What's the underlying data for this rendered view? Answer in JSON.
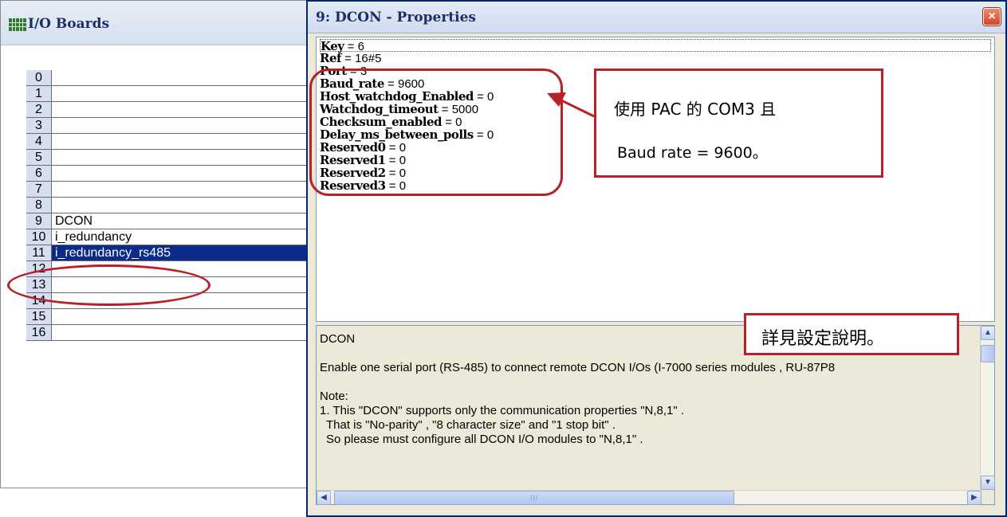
{
  "io_boards": {
    "title": "I/O Boards",
    "rows": [
      {
        "num": "0",
        "name": ""
      },
      {
        "num": "1",
        "name": ""
      },
      {
        "num": "2",
        "name": ""
      },
      {
        "num": "3",
        "name": ""
      },
      {
        "num": "4",
        "name": ""
      },
      {
        "num": "5",
        "name": ""
      },
      {
        "num": "6",
        "name": ""
      },
      {
        "num": "7",
        "name": ""
      },
      {
        "num": "8",
        "name": ""
      },
      {
        "num": "9",
        "name": "DCON"
      },
      {
        "num": "10",
        "name": "i_redundancy"
      },
      {
        "num": "11",
        "name": "i_redundancy_rs485",
        "selected": true
      },
      {
        "num": "12",
        "name": ""
      },
      {
        "num": "13",
        "name": ""
      },
      {
        "num": "14",
        "name": ""
      },
      {
        "num": "15",
        "name": ""
      },
      {
        "num": "16",
        "name": ""
      }
    ]
  },
  "properties": {
    "title": "9: DCON - Properties",
    "close_glyph": "×",
    "lines": [
      {
        "key": "Key",
        "value": "6"
      },
      {
        "key": "Ref",
        "value": "16#5"
      },
      {
        "key": "Port",
        "value": "3"
      },
      {
        "key": "Baud_rate",
        "value": "9600"
      },
      {
        "key": "Host_watchdog_Enabled",
        "value": "0"
      },
      {
        "key": "Watchdog_timeout",
        "value": "5000"
      },
      {
        "key": "Checksum_enabled",
        "value": "0"
      },
      {
        "key": "Delay_ms_between_polls",
        "value": "0"
      },
      {
        "key": "Reserved0",
        "value": "0"
      },
      {
        "key": "Reserved1",
        "value": "0"
      },
      {
        "key": "Reserved2",
        "value": "0"
      },
      {
        "key": "Reserved3",
        "value": "0"
      }
    ],
    "description": {
      "heading": "DCON",
      "intro": "Enable one serial port (RS-485) to connect remote DCON I/Os (I-7000 series modules , RU-87P8",
      "note_label": "Note:",
      "note_1": "1. This \"DCON\" supports only the communication properties \"N,8,1\" .",
      "note_2": "That is \"No-parity\" , \"8 character size\" and \"1 stop bit\" .",
      "note_3": "So please must configure all DCON I/O modules to \"N,8,1\" ."
    },
    "scroll_up": "▲",
    "scroll_down": "▼",
    "scroll_left": "◀",
    "scroll_right": "▶",
    "thumb_grip": "III"
  },
  "annotations": {
    "com3_line1": "使用 PAC 的 COM3 且",
    "com3_line2": "Baud rate  = 9600。",
    "detail": "詳見設定說明。"
  },
  "colors": {
    "annotation_red": "#b8202a",
    "selection_blue": "#0b2a8a",
    "title_text": "#1a2f68"
  }
}
